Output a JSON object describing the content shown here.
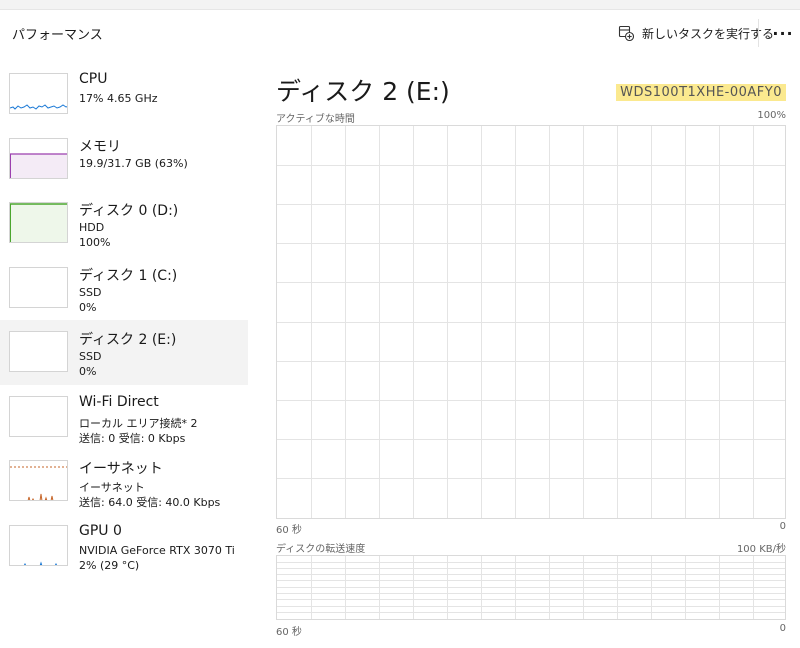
{
  "header": {
    "title": "パフォーマンス",
    "run_task_label": "新しいタスクを実行する",
    "more_label": "···"
  },
  "sidebar": {
    "items": [
      {
        "name": "CPU",
        "sub1": "17%  4.65 GHz",
        "sub2": "",
        "color": "#1c7ad6"
      },
      {
        "name": "メモリ",
        "sub1": "19.9/31.7 GB (63%)",
        "sub2": "",
        "color": "#9b3fae"
      },
      {
        "name": "ディスク 0 (D:)",
        "sub1": "HDD",
        "sub2": "100%",
        "color": "#4aa52e"
      },
      {
        "name": "ディスク 1 (C:)",
        "sub1": "SSD",
        "sub2": "0%",
        "color": "#4aa52e"
      },
      {
        "name": "ディスク 2 (E:)",
        "sub1": "SSD",
        "sub2": "0%",
        "color": "#4aa52e",
        "active": true
      },
      {
        "name": "Wi-Fi Direct",
        "sub1": "ローカル エリア接続* 2",
        "sub2": "送信: 0  受信: 0 Kbps",
        "color": "#c6662a"
      },
      {
        "name": "イーサネット",
        "sub1": "イーサネット",
        "sub2": "送信: 64.0  受信: 40.0 Kbps",
        "color": "#c6662a"
      },
      {
        "name": "GPU 0",
        "sub1": "NVIDIA GeForce RTX 3070 Ti",
        "sub2": "2%  (29 °C)",
        "color": "#1c7ad6"
      }
    ]
  },
  "main": {
    "title": "ディスク 2 (E:)",
    "model": "WDS100T1XHE-00AFY0",
    "active_time": {
      "label": "アクティブな時間",
      "max_label": "100%",
      "x_left_label": "60 秒",
      "x_right_label": "0"
    },
    "transfer_rate": {
      "label": "ディスクの転送速度",
      "max_label": "100 KB/秒",
      "x_left_label": "60 秒",
      "x_right_label": "0"
    }
  },
  "colors": {
    "disk_accent": "#4aa52e",
    "model_highlight": "#fbe98f",
    "grid_line": "#e4e4e4"
  }
}
